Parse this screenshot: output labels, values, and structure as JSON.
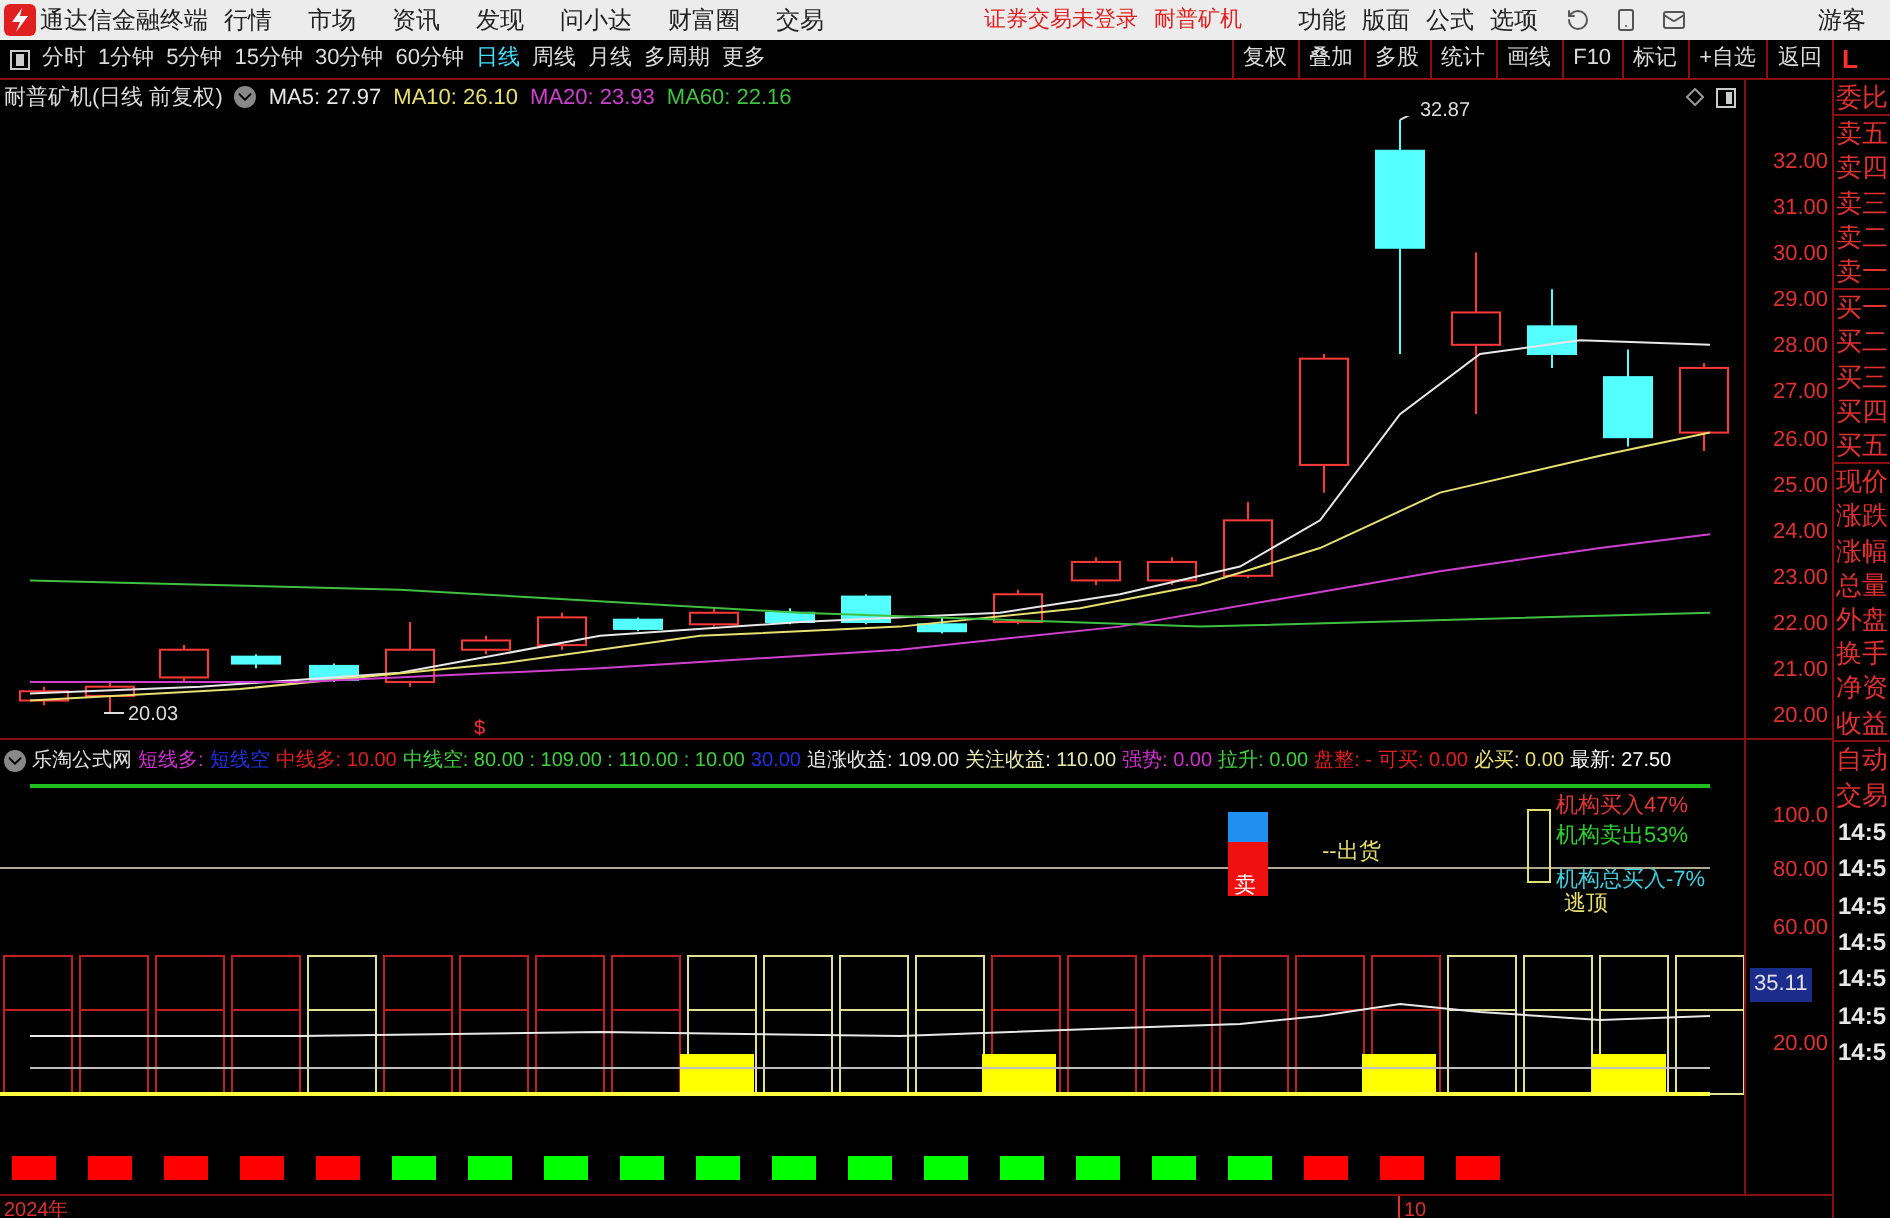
{
  "app": {
    "title": "通达信金融终端"
  },
  "menu": [
    "行情",
    "市场",
    "资讯",
    "发现",
    "问小达",
    "财富圈",
    "交易"
  ],
  "login_status": "证券交易未登录",
  "stock_name": "耐普矿机",
  "right_menu": [
    "功能",
    "版面",
    "公式",
    "选项"
  ],
  "user": "游客",
  "periods": [
    {
      "label": "分时",
      "selected": false
    },
    {
      "label": "1分钟",
      "selected": false
    },
    {
      "label": "5分钟",
      "selected": false
    },
    {
      "label": "15分钟",
      "selected": false
    },
    {
      "label": "30分钟",
      "selected": false
    },
    {
      "label": "60分钟",
      "selected": false
    },
    {
      "label": "日线",
      "selected": true
    },
    {
      "label": "周线",
      "selected": false
    },
    {
      "label": "月线",
      "selected": false
    },
    {
      "label": "多周期",
      "selected": false
    },
    {
      "label": "更多",
      "selected": false
    }
  ],
  "tools": [
    "复权",
    "叠加",
    "多股",
    "统计",
    "画线",
    "F10",
    "标记",
    "+自选",
    "返回"
  ],
  "side_mode": "L",
  "chart": {
    "title": "耐普矿机(日线 前复权)",
    "ma": [
      {
        "label": "MA5: 27.97",
        "color": "#e8e8e8"
      },
      {
        "label": "MA10: 26.10",
        "color": "#e6e070"
      },
      {
        "label": "MA20: 23.93",
        "color": "#d040d0"
      },
      {
        "label": "MA60: 22.16",
        "color": "#40c040"
      }
    ],
    "high_label": "32.87",
    "low_label": "20.03",
    "marker": "$",
    "price_ticks": [
      "32.00",
      "31.00",
      "30.00",
      "29.00",
      "28.00",
      "27.00",
      "26.00",
      "25.00",
      "24.00",
      "23.00",
      "22.00",
      "21.00",
      "20.00"
    ]
  },
  "indicator": {
    "header": [
      {
        "text": "乐淘公式网",
        "color": "#e0e0e0"
      },
      {
        "text": "短线多:",
        "color": "#d030d0"
      },
      {
        "text": "短线空",
        "color": "#2030e0"
      },
      {
        "text": "中线多: 10.00",
        "color": "#e02020"
      },
      {
        "text": "中线空: 80.00 : 109.00 : 110.00 : 10.00",
        "color": "#40d040"
      },
      {
        "text": "30.00",
        "color": "#2030e0"
      },
      {
        "text": "追涨收益: 109.00",
        "color": "#e8e8e8"
      },
      {
        "text": "关注收益: 110.00",
        "color": "#e8e8b0"
      },
      {
        "text": "强势: 0.00",
        "color": "#d030d0"
      },
      {
        "text": "拉升: 0.00",
        "color": "#40d040"
      },
      {
        "text": "盘整: -",
        "color": "#e02020"
      },
      {
        "text": "可买: 0.00",
        "color": "#e02020"
      },
      {
        "text": "必买: 0.00",
        "color": "#e8e070"
      },
      {
        "text": "最新: 27.50",
        "color": "#ffffff"
      }
    ],
    "sell_label": "卖",
    "ship_label": "--出货",
    "notes": [
      {
        "text": "机构买入47%",
        "color": "#e03838"
      },
      {
        "text": "机构卖出53%",
        "color": "#30d030"
      },
      {
        "text": "机构总买入-7%",
        "color": "#40d0e0"
      },
      {
        "text": "逃顶",
        "color": "#e8e070"
      }
    ],
    "axis": [
      "100.0",
      "80.00",
      "60.00",
      "20.00"
    ],
    "current": "35.11",
    "signals": [
      {
        "color": "#ff0000"
      },
      {
        "color": "#ff0000"
      },
      {
        "color": "#ff0000"
      },
      {
        "color": "#ff0000"
      },
      {
        "color": "#ff0000"
      },
      {
        "color": "#00ff00"
      },
      {
        "color": "#00ff00"
      },
      {
        "color": "#00ff00"
      },
      {
        "color": "#00ff00"
      },
      {
        "color": "#00ff00"
      },
      {
        "color": "#00ff00"
      },
      {
        "color": "#00ff00"
      },
      {
        "color": "#00ff00"
      },
      {
        "color": "#00ff00"
      },
      {
        "color": "#00ff00"
      },
      {
        "color": "#00ff00"
      },
      {
        "color": "#00ff00"
      },
      {
        "color": "#ff0000"
      },
      {
        "color": "#ff0000"
      },
      {
        "color": "#ff0000"
      }
    ]
  },
  "date_axis": [
    "2024年",
    "10"
  ],
  "side_panel": {
    "quote_labels": [
      "委比",
      "卖五",
      "卖四",
      "卖三",
      "卖二",
      "卖一",
      "买一",
      "买二",
      "买三",
      "买四",
      "买五",
      "现价",
      "涨跌",
      "涨幅",
      "总量",
      "外盘",
      "换手",
      "净资",
      "收益"
    ],
    "trade_labels": [
      "自动",
      "交易"
    ],
    "times": [
      "14:5",
      "14:5",
      "14:5",
      "14:5",
      "14:5",
      "14:5",
      "14:5"
    ]
  }
}
